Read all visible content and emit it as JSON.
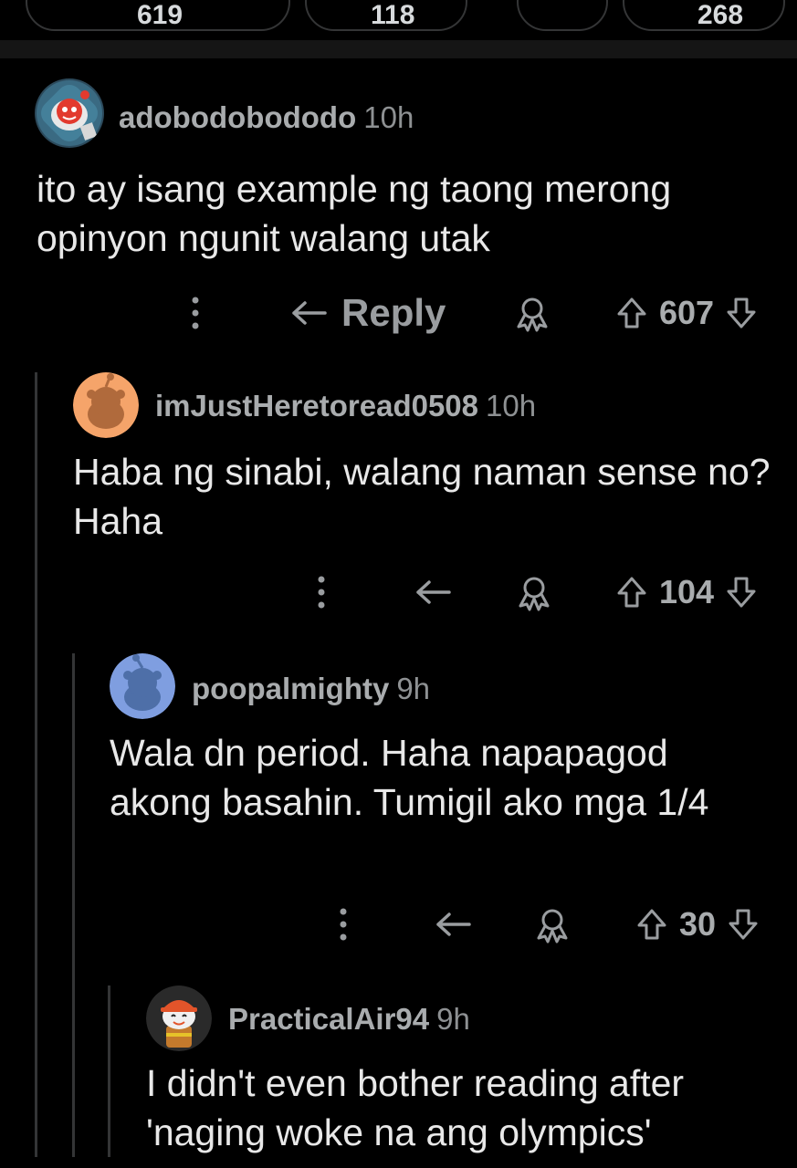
{
  "top_bar": {
    "pills": [
      "619",
      "",
      "118",
      "",
      "268"
    ]
  },
  "comments": [
    {
      "username": "adobodobododo",
      "time": "10h",
      "body": "ito ay isang example ng taong merong opinyon ngunit walang utak",
      "reply_label": "Reply",
      "score": "607",
      "avatar_icon": "snoo-astronaut-avatar-icon"
    },
    {
      "username": "imJustHeretoread0508",
      "time": "10h",
      "body": "Haba ng sinabi, walang naman sense no? Haha",
      "reply_label": "",
      "score": "104",
      "avatar_icon": "snoo-orange-avatar-icon"
    },
    {
      "username": "poopalmighty",
      "time": "9h",
      "body": "Wala dn period. Haha napapagod akong basahin. Tumigil ako mga 1/4",
      "reply_label": "",
      "score": "30",
      "avatar_icon": "snoo-blue-avatar-icon"
    },
    {
      "username": "PracticalAir94",
      "time": "9h",
      "body": "I didn't even bother reading after 'naging woke na ang olympics'",
      "reply_label": "",
      "score": "",
      "avatar_icon": "snoo-firefighter-avatar-icon"
    }
  ],
  "colors": {
    "background": "#000000",
    "text": "#e8e8e8",
    "muted": "#9a9da0",
    "thread_line": "#343536"
  }
}
